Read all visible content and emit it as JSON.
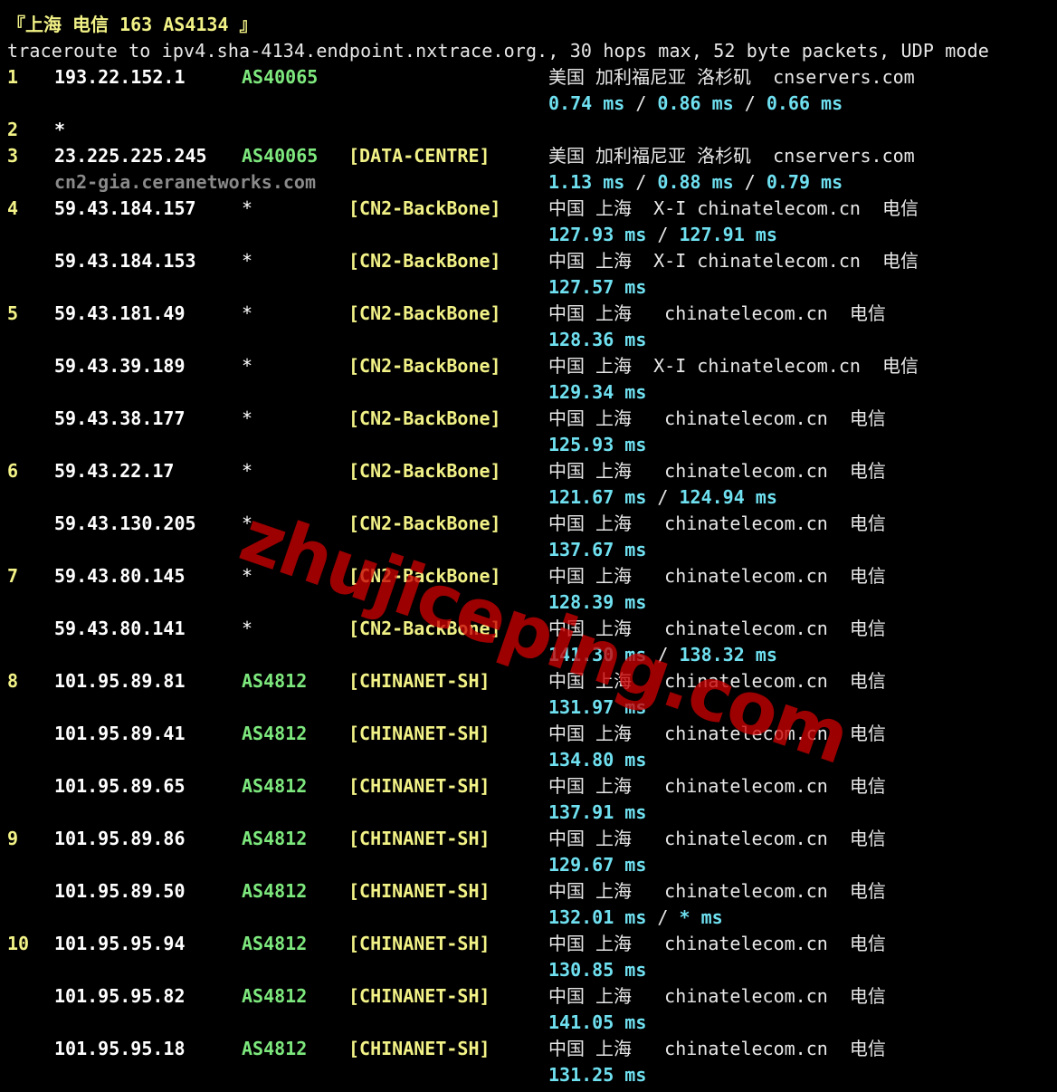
{
  "header": {
    "title": "『上海 电信 163 AS4134 』",
    "command": "traceroute to ipv4.sha-4134.endpoint.nxtrace.org., 30 hops max, 52 byte packets, UDP mode"
  },
  "watermark": "zhujiceping.com",
  "colors": {
    "background": "#000000",
    "hop_number": "#f2f287",
    "asn": "#7de87d",
    "rtt": "#6fe0f0",
    "tag": "#f2f287",
    "rdns": "#8a8a8a"
  },
  "rows": [
    {
      "hop": "1",
      "ip": "193.22.152.1",
      "asn": "AS40065",
      "tag": "",
      "geo": "美国 加利福尼亚 洛杉矶  cnservers.com",
      "rtt": [
        "0.74 ms",
        "0.86 ms",
        "0.66 ms"
      ]
    },
    {
      "hop": "2",
      "star": "*"
    },
    {
      "hop": "3",
      "ip": "23.225.225.245",
      "asn": "AS40065",
      "tag": "[DATA-CENTRE]",
      "geo": "美国 加利福尼亚 洛杉矶  cnservers.com",
      "rdns": "cn2-gia.ceranetworks.com",
      "rtt": [
        "1.13 ms",
        "0.88 ms",
        "0.79 ms"
      ]
    },
    {
      "hop": "4",
      "ip": "59.43.184.157",
      "asn": "*",
      "tag": "[CN2-BackBone]",
      "geo": "中国 上海  X-I chinatelecom.cn  电信",
      "rtt": [
        "127.93 ms",
        "127.91 ms"
      ]
    },
    {
      "hop": "",
      "ip": "59.43.184.153",
      "asn": "*",
      "tag": "[CN2-BackBone]",
      "geo": "中国 上海  X-I chinatelecom.cn  电信",
      "rtt": [
        "127.57 ms"
      ]
    },
    {
      "hop": "5",
      "ip": "59.43.181.49",
      "asn": "*",
      "tag": "[CN2-BackBone]",
      "geo": "中国 上海   chinatelecom.cn  电信",
      "rtt": [
        "128.36 ms"
      ]
    },
    {
      "hop": "",
      "ip": "59.43.39.189",
      "asn": "*",
      "tag": "[CN2-BackBone]",
      "geo": "中国 上海  X-I chinatelecom.cn  电信",
      "rtt": [
        "129.34 ms"
      ]
    },
    {
      "hop": "",
      "ip": "59.43.38.177",
      "asn": "*",
      "tag": "[CN2-BackBone]",
      "geo": "中国 上海   chinatelecom.cn  电信",
      "rtt": [
        "125.93 ms"
      ]
    },
    {
      "hop": "6",
      "ip": "59.43.22.17",
      "asn": "*",
      "tag": "[CN2-BackBone]",
      "geo": "中国 上海   chinatelecom.cn  电信",
      "rtt": [
        "121.67 ms",
        "124.94 ms"
      ]
    },
    {
      "hop": "",
      "ip": "59.43.130.205",
      "asn": "*",
      "tag": "[CN2-BackBone]",
      "geo": "中国 上海   chinatelecom.cn  电信",
      "rtt": [
        "137.67 ms"
      ]
    },
    {
      "hop": "7",
      "ip": "59.43.80.145",
      "asn": "*",
      "tag": "[CN2-BackBone]",
      "geo": "中国 上海   chinatelecom.cn  电信",
      "rtt": [
        "128.39 ms"
      ]
    },
    {
      "hop": "",
      "ip": "59.43.80.141",
      "asn": "*",
      "tag": "[CN2-BackBone]",
      "geo": "中国 上海   chinatelecom.cn  电信",
      "rtt": [
        "141.30 ms",
        "138.32 ms"
      ]
    },
    {
      "hop": "8",
      "ip": "101.95.89.81",
      "asn": "AS4812",
      "tag": "[CHINANET-SH]",
      "geo": "中国 上海   chinatelecom.cn  电信",
      "rtt": [
        "131.97 ms"
      ]
    },
    {
      "hop": "",
      "ip": "101.95.89.41",
      "asn": "AS4812",
      "tag": "[CHINANET-SH]",
      "geo": "中国 上海   chinatelecom.cn  电信",
      "rtt": [
        "134.80 ms"
      ]
    },
    {
      "hop": "",
      "ip": "101.95.89.65",
      "asn": "AS4812",
      "tag": "[CHINANET-SH]",
      "geo": "中国 上海   chinatelecom.cn  电信",
      "rtt": [
        "137.91 ms"
      ]
    },
    {
      "hop": "9",
      "ip": "101.95.89.86",
      "asn": "AS4812",
      "tag": "[CHINANET-SH]",
      "geo": "中国 上海   chinatelecom.cn  电信",
      "rtt": [
        "129.67 ms"
      ]
    },
    {
      "hop": "",
      "ip": "101.95.89.50",
      "asn": "AS4812",
      "tag": "[CHINANET-SH]",
      "geo": "中国 上海   chinatelecom.cn  电信",
      "rtt": [
        "132.01 ms",
        "* ms"
      ]
    },
    {
      "hop": "10",
      "ip": "101.95.95.94",
      "asn": "AS4812",
      "tag": "[CHINANET-SH]",
      "geo": "中国 上海   chinatelecom.cn  电信",
      "rtt": [
        "130.85 ms"
      ]
    },
    {
      "hop": "",
      "ip": "101.95.95.82",
      "asn": "AS4812",
      "tag": "[CHINANET-SH]",
      "geo": "中国 上海   chinatelecom.cn  电信",
      "rtt": [
        "141.05 ms"
      ]
    },
    {
      "hop": "",
      "ip": "101.95.95.18",
      "asn": "AS4812",
      "tag": "[CHINANET-SH]",
      "geo": "中国 上海   chinatelecom.cn  电信",
      "rtt": [
        "131.25 ms"
      ]
    }
  ]
}
